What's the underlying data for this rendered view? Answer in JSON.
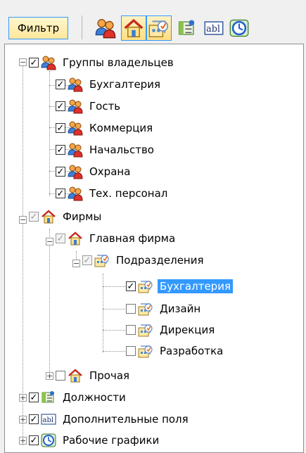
{
  "toolbar": {
    "filter_label": "Фильтр",
    "buttons": [
      {
        "icon": "owner-groups-icon",
        "pressed": false
      },
      {
        "icon": "firms-icon",
        "pressed": true
      },
      {
        "icon": "departments-icon",
        "pressed": true
      },
      {
        "icon": "positions-icon",
        "pressed": false
      },
      {
        "icon": "extra-fields-icon",
        "pressed": false
      },
      {
        "icon": "work-schedules-icon",
        "pressed": false
      }
    ]
  },
  "tree": {
    "owner_groups": {
      "label": "Группы владельцев",
      "checked": true,
      "children": [
        "Бухгалтерия",
        "Гость",
        "Коммерция",
        "Начальство",
        "Охрана",
        "Тех. персонал"
      ]
    },
    "firms": {
      "label": "Фирмы",
      "state": "grey",
      "main_firm": {
        "label": "Главная фирма",
        "state": "grey",
        "departments": {
          "label": "Подразделения",
          "state": "grey",
          "children": [
            {
              "label": "Бухгалтерия",
              "checked": true,
              "selected": true
            },
            {
              "label": "Дизайн",
              "checked": false
            },
            {
              "label": "Дирекция",
              "checked": false
            },
            {
              "label": "Разработка",
              "checked": false
            }
          ]
        }
      },
      "other": {
        "label": "Прочая",
        "checked": false
      }
    },
    "positions": {
      "label": "Должности",
      "checked": true
    },
    "extra_fields": {
      "label": "Дополнительные поля",
      "checked": true
    },
    "schedules": {
      "label": "Рабочие графики",
      "checked": true
    }
  }
}
